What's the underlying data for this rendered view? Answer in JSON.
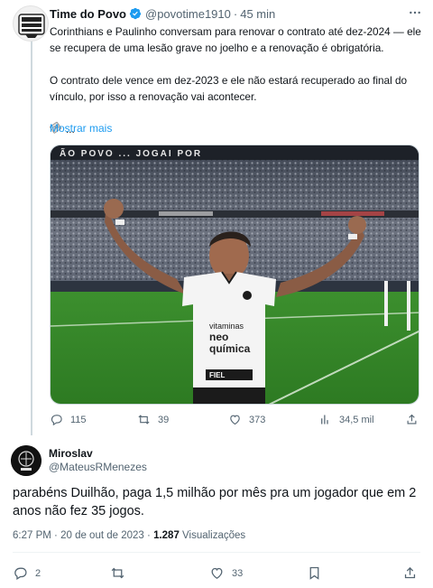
{
  "parent_tweet": {
    "author_name": "Time do Povo",
    "handle": "@povotime1910",
    "separator": "·",
    "time": "45 min",
    "paragraphs": [
      "Corinthians e Paulinho conversam para renovar o contrato até dez-2024 — ele se recupera de uma lesão grave no joelho e a renovação é obrigatória.",
      "O contrato dele vence em dez-2023 e ele não estará recuperado ao final do vínculo, por isso a renovação vai acontecer."
    ],
    "ellipsis": "...",
    "show_more": "Mostrar mais",
    "photo": {
      "stadium_banner": "ÃO POVO ... JOGAI POR",
      "shirt_sponsor_line1": "vitaminas",
      "shirt_sponsor_line2": "neo",
      "shirt_sponsor_line3": "química",
      "shirt_bottom_sponsor": "FIEL"
    },
    "actions": {
      "replies": "115",
      "reposts": "39",
      "likes": "373",
      "views": "34,5 mil"
    }
  },
  "reply_tweet": {
    "author_name": "Miroslav",
    "handle": "@MateusRMenezes",
    "text": "parabéns Duilhão, paga 1,5 milhão por mês pra um jogador que em 2 anos não fez 35 jogos.",
    "time": "6:27 PM",
    "separator": "·",
    "date": "20 de out de 2023",
    "views_count": "1.287",
    "views_label": "Visualizações",
    "actions": {
      "replies": "2",
      "likes": "33"
    }
  },
  "colors": {
    "accent": "#1d9bf0",
    "muted": "#536471",
    "text": "#0f1419",
    "border": "#cfd9de"
  }
}
